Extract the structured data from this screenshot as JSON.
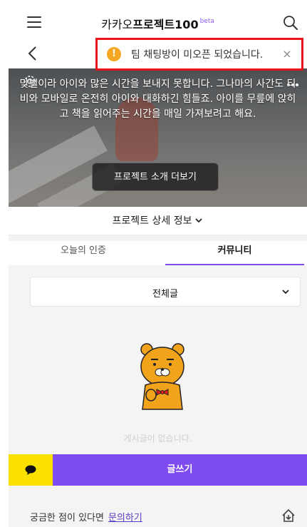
{
  "header": {
    "title_prefix": "카카오",
    "title_main": "프로젝트100",
    "title_badge": "beta"
  },
  "toast": {
    "message": "팀 채팅방이 미오픈 되었습니다.",
    "icon": "exclamation-circle-icon",
    "close_symbol": "×"
  },
  "hero": {
    "description": "맞벌이라 아이와 많은 시간을 보내지 못합니다. 그나마의 사간도 티비와 모바일로 온전히 아이와 대화하긴 힘들죠. 아이를 무릎에 앉히고 책을 읽어주는 시간을 매일 가져보려고 해요.",
    "intro_button": "프로젝트 소개 더보기"
  },
  "details_toggle": "프로젝트 상세 정보",
  "tabs": [
    {
      "label": "오늘의 인증",
      "active": false
    },
    {
      "label": "커뮤니티",
      "active": true
    }
  ],
  "filter": {
    "selected": "전체글"
  },
  "empty_state": {
    "message": "게시글이 없습니다."
  },
  "actions": {
    "write_label": "글쓰기"
  },
  "footer": {
    "question_text": "궁금한 점이 있다면",
    "inquiry_link": "문의하기"
  },
  "colors": {
    "accent_purple": "#7e4bf0",
    "chat_yellow": "#fae100",
    "toast_border": "#e8141b",
    "warning_orange": "#f5a623"
  }
}
